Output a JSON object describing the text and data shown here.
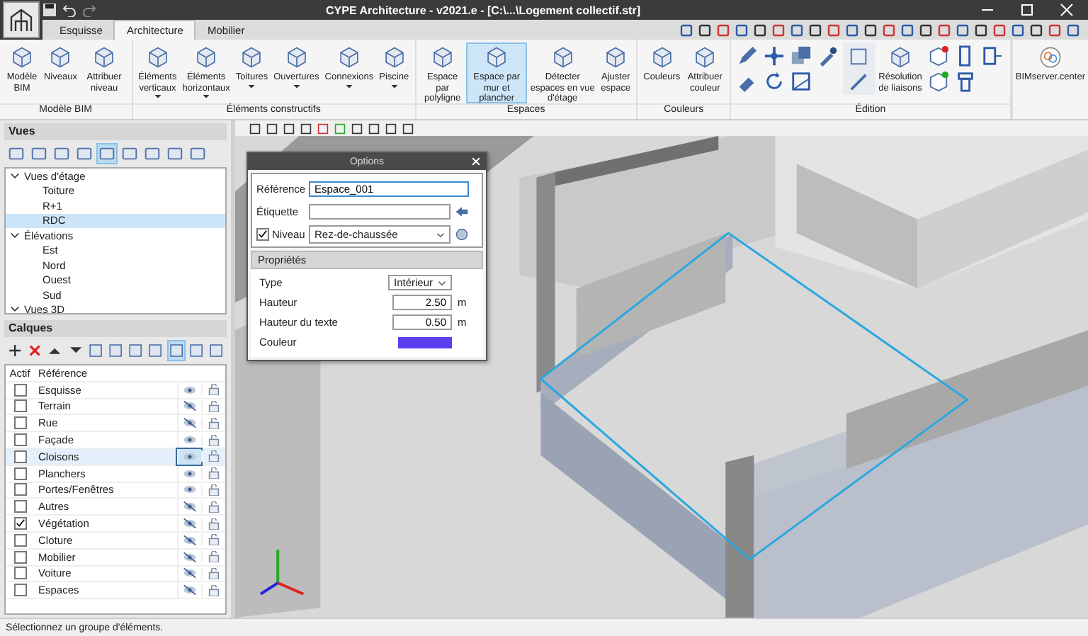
{
  "window": {
    "title": "CYPE Architecture - v2021.e - [C:\\...\\Logement collectif.str]"
  },
  "tabs": [
    {
      "label": "Esquisse",
      "selected": false
    },
    {
      "label": "Architecture",
      "selected": true
    },
    {
      "label": "Mobilier",
      "selected": false
    }
  ],
  "ribbon": {
    "groups": [
      {
        "label": "Modèle BIM",
        "buttons": [
          {
            "label": "Modèle BIM",
            "dropdown": false,
            "selected": false
          },
          {
            "label": "Niveaux",
            "dropdown": false,
            "selected": false
          },
          {
            "label": "Attribuer niveau",
            "dropdown": false,
            "selected": false
          }
        ]
      },
      {
        "label": "Éléments constructifs",
        "buttons": [
          {
            "label": "Éléments verticaux",
            "dropdown": true,
            "selected": false
          },
          {
            "label": "Éléments horizontaux",
            "dropdown": true,
            "selected": false
          },
          {
            "label": "Toitures",
            "dropdown": true,
            "selected": false
          },
          {
            "label": "Ouvertures",
            "dropdown": true,
            "selected": false
          },
          {
            "label": "Connexions",
            "dropdown": true,
            "selected": false
          },
          {
            "label": "Piscine",
            "dropdown": true,
            "selected": false
          }
        ]
      },
      {
        "label": "Espaces",
        "buttons": [
          {
            "label": "Espace par polyligne",
            "dropdown": false,
            "selected": false
          },
          {
            "label": "Espace par mur et plancher",
            "dropdown": false,
            "selected": true
          },
          {
            "label": "Détecter espaces en vue d'étage",
            "dropdown": false,
            "selected": false
          },
          {
            "label": "Ajuster espace",
            "dropdown": false,
            "selected": false
          }
        ]
      },
      {
        "label": "Couleurs",
        "buttons": [
          {
            "label": "Couleurs",
            "dropdown": false,
            "selected": false
          },
          {
            "label": "Attribuer couleur",
            "dropdown": false,
            "selected": false
          }
        ]
      },
      {
        "label": "Édition",
        "buttons": [
          {
            "label": "Résolution de liaisons",
            "selected": false
          }
        ]
      }
    ],
    "bimserver": {
      "label": "BIMserver.center"
    }
  },
  "views": {
    "title": "Vues",
    "tree": [
      {
        "label": "Vues d'étage",
        "expanded": true,
        "selected": false,
        "children": [
          {
            "label": "Toiture",
            "selected": false
          },
          {
            "label": "R+1",
            "selected": false
          },
          {
            "label": "RDC",
            "selected": true
          }
        ]
      },
      {
        "label": "Élévations",
        "expanded": true,
        "selected": false,
        "children": [
          {
            "label": "Est",
            "selected": false
          },
          {
            "label": "Nord",
            "selected": false
          },
          {
            "label": "Ouest",
            "selected": false
          },
          {
            "label": "Sud",
            "selected": false
          }
        ]
      },
      {
        "label": "Vues 3D",
        "expanded": true,
        "selected": false
      }
    ]
  },
  "layers": {
    "title": "Calques",
    "columns": [
      "Actif",
      "Référence"
    ],
    "rows": [
      {
        "name": "Esquisse",
        "active": false,
        "visible": true,
        "selected": false
      },
      {
        "name": "Terrain",
        "active": false,
        "visible": false,
        "selected": false
      },
      {
        "name": "Rue",
        "active": false,
        "visible": false,
        "selected": false
      },
      {
        "name": "Façade",
        "active": false,
        "visible": true,
        "selected": false
      },
      {
        "name": "Cloisons",
        "active": false,
        "visible": true,
        "selected": true
      },
      {
        "name": "Planchers",
        "active": false,
        "visible": true,
        "selected": false
      },
      {
        "name": "Portes/Fenêtres",
        "active": false,
        "visible": true,
        "selected": false
      },
      {
        "name": "Autres",
        "active": false,
        "visible": false,
        "selected": false
      },
      {
        "name": "Végétation",
        "active": true,
        "visible": false,
        "selected": false
      },
      {
        "name": "Cloture",
        "active": false,
        "visible": false,
        "selected": false
      },
      {
        "name": "Mobilier",
        "active": false,
        "visible": false,
        "selected": false
      },
      {
        "name": "Voiture",
        "active": false,
        "visible": false,
        "selected": false
      },
      {
        "name": "Espaces",
        "active": false,
        "visible": false,
        "selected": false
      }
    ]
  },
  "dialog": {
    "title": "Options",
    "reference": {
      "label": "Référence",
      "value": "Espace_001"
    },
    "tag": {
      "label": "Étiquette"
    },
    "level": {
      "label": "Niveau",
      "checked": true,
      "value": "Rez-de-chaussée"
    },
    "section": "Propriétés",
    "properties": [
      {
        "kind": "select",
        "label": "Type",
        "value": "Intérieur"
      },
      {
        "kind": "number",
        "label": "Hauteur",
        "value": "2.50",
        "unit": "m"
      },
      {
        "kind": "number",
        "label": "Hauteur du texte",
        "value": "0.50",
        "unit": "m"
      },
      {
        "kind": "color",
        "label": "Couleur",
        "color": "#5b3ff0"
      }
    ]
  },
  "status_bar": {
    "text": "Sélectionnez un groupe d'éléments."
  }
}
